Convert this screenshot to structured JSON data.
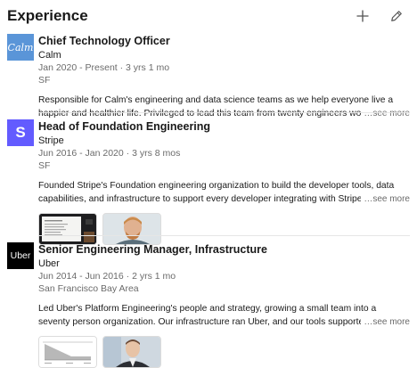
{
  "section": {
    "title": "Experience",
    "add_icon": "plus-icon",
    "edit_icon": "pencil-icon"
  },
  "experiences": [
    {
      "logo_text": "Calm",
      "logo_color": "#4f8fd6",
      "title": "Chief Technology Officer",
      "company": "Calm",
      "dates": "Jan 2020 - Present · 3 yrs 1 mo",
      "location": "SF",
      "description": "Responsible for Calm's engineering and data science teams as we help everyone live a happier and healthier life. Privileged to lead this team from twenty engineers working in one business unit",
      "see_more": "…see more"
    },
    {
      "logo_text": "S",
      "logo_color": "#635bff",
      "title": "Head of Foundation Engineering",
      "company": "Stripe",
      "dates": "Jun 2016 - Jan 2020 · 3 yrs 8 mos",
      "location": "SF",
      "description": "Founded Stripe's Foundation engineering organization to build the developer tools, data capabilities, and infrastructure to support every developer integrating with Stripe, every engineer building Strip",
      "see_more": "…see more"
    },
    {
      "logo_text": "Uber",
      "logo_color": "#000000",
      "title": "Senior Engineering Manager, Infrastructure",
      "company": "Uber",
      "dates": "Jun 2014 - Jun 2016 · 2 yrs 1 mo",
      "location": "San Francisco Bay Area",
      "description": "Led Uber's Platform Engineering's people and strategy, growing a small team into a seventy person organization. Our infrastructure ran Uber, and our tools supported Uber's 2,000+ engineers.",
      "see_more": "…see more"
    }
  ]
}
